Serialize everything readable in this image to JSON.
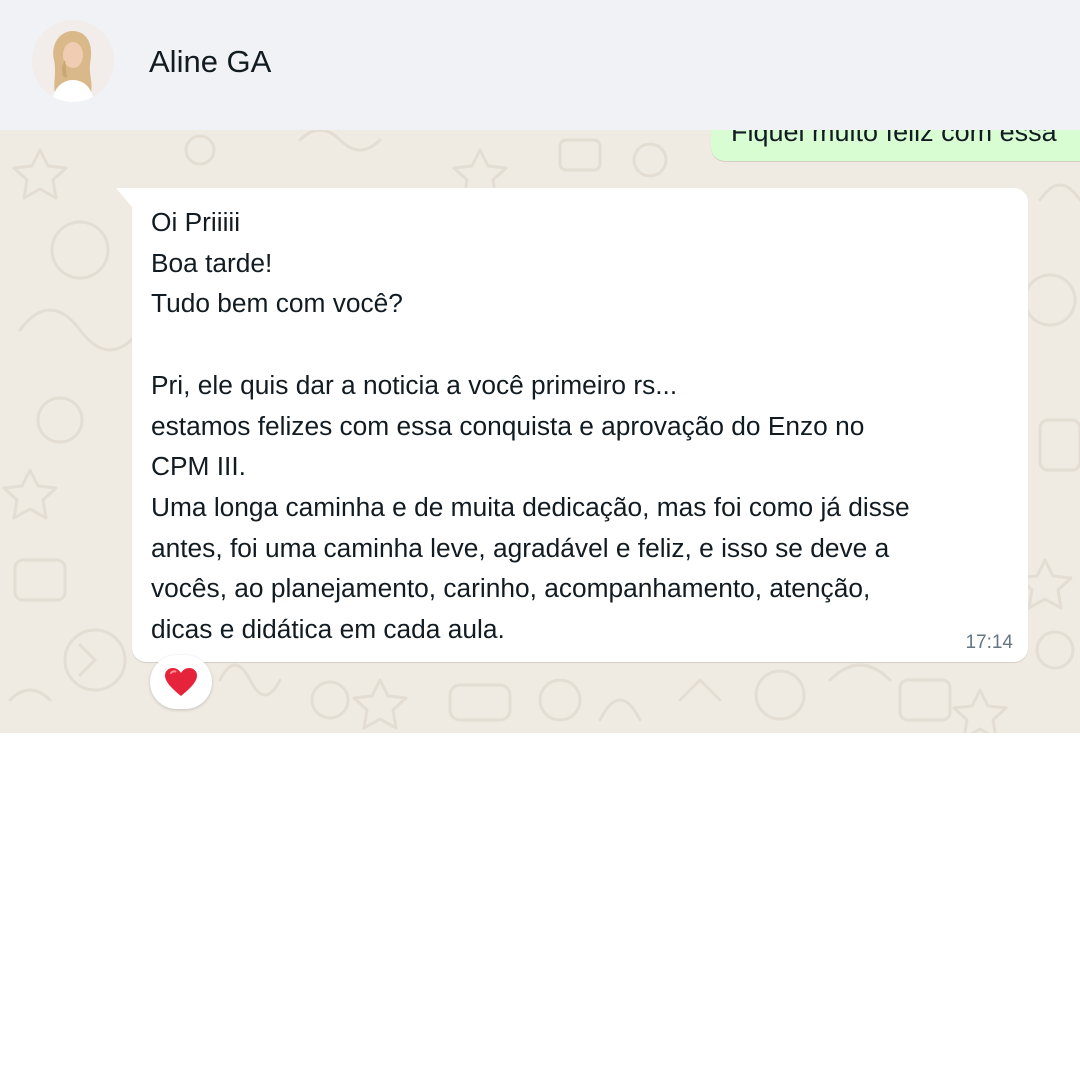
{
  "header": {
    "contact_name": "Aline GA",
    "avatar_icon": "contact-avatar-photo",
    "background": "#f0f2f5"
  },
  "chat": {
    "wallpaper_color": "#efeae2",
    "outgoing_message": {
      "partial_text": "Fiquei muito feliz com essa",
      "bubble_color": "#d9fdd3"
    },
    "incoming_message": {
      "text": "Oi Priiiii\nBoa tarde!\nTudo bem com você?\n\nPri, ele quis dar a noticia a você primeiro rs...\nestamos felizes com essa conquista e aprovação do Enzo no\nCPM III.\nUma longa caminha e de muita dedicação, mas foi como já disse\nantes, foi uma caminha leve, agradável e feliz, e isso se deve a\nvocês, ao planejamento, carinho, acompanhamento, atenção,\ndicas e didática em cada aula.",
      "time": "17:14",
      "bubble_color": "#ffffff"
    },
    "reaction": {
      "icon": "red-heart-icon",
      "color": "#e5243b"
    }
  }
}
